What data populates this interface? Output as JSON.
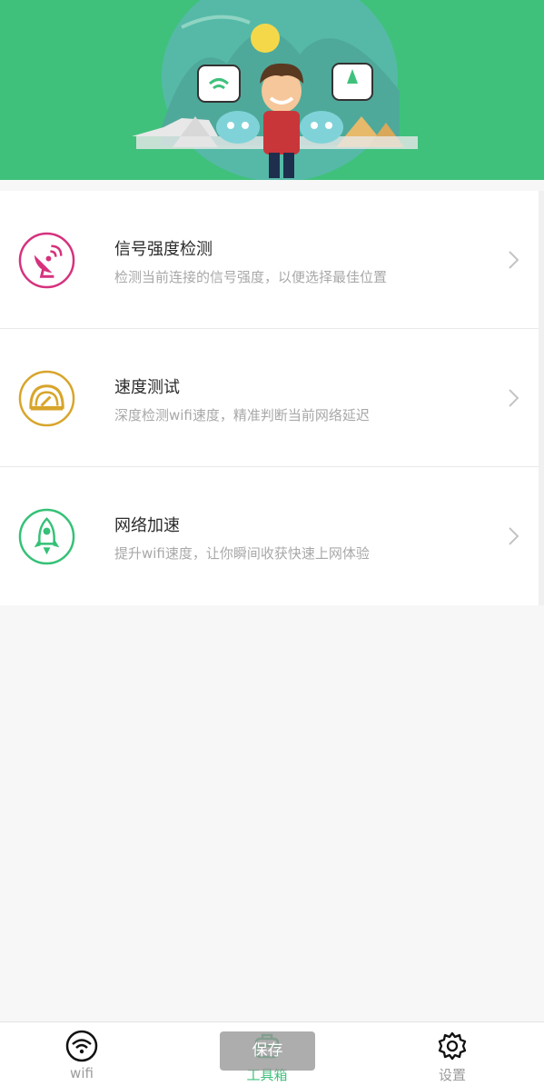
{
  "banner": {
    "illustration": "cartoon-man-with-routers-and-robots",
    "bg_color": "#3fc17c"
  },
  "tools": [
    {
      "title": "信号强度检测",
      "desc": "检测当前连接的信号强度，以便选择最佳位置",
      "icon": "satellite-dish-icon",
      "color": "#d6317d"
    },
    {
      "title": "速度测试",
      "desc": "深度检测wifi速度，精准判断当前网络延迟",
      "icon": "speedometer-icon",
      "color": "#d8a52a"
    },
    {
      "title": "网络加速",
      "desc": "提升wifi速度，让你瞬间收获快速上网体验",
      "icon": "rocket-icon",
      "color": "#34c176"
    }
  ],
  "tabbar": {
    "tabs": [
      {
        "label": "wifi",
        "icon": "wifi-icon"
      },
      {
        "label": "工具箱",
        "icon": "toolbox-icon"
      },
      {
        "label": "设置",
        "icon": "settings-gear-icon"
      }
    ],
    "active_index": 1,
    "active_color": "#3fc17c"
  },
  "toast": {
    "label": "保存"
  }
}
